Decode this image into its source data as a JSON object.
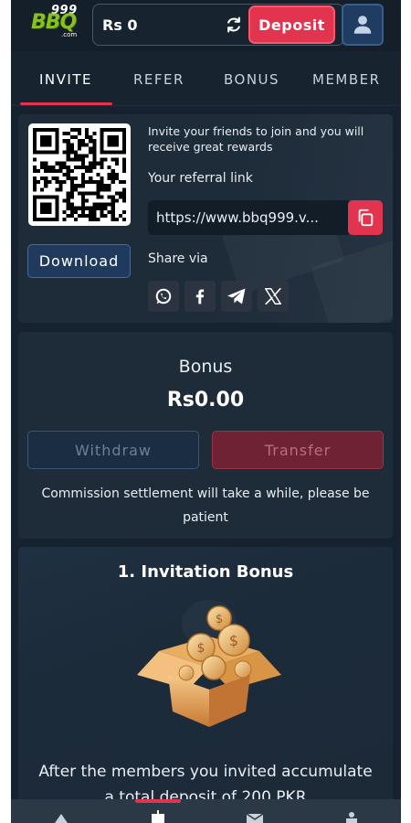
{
  "header": {
    "logo_number": "999",
    "logo_brand": "BBQ",
    "logo_domain": ".com",
    "balance": "Rs 0",
    "deposit_label": "Deposit"
  },
  "tabs": [
    {
      "label": "INVITE",
      "active": true
    },
    {
      "label": "REFER",
      "active": false
    },
    {
      "label": "BONUS",
      "active": false
    },
    {
      "label": "MEMBER",
      "active": false
    }
  ],
  "invite": {
    "description": "Invite your friends to join and you will receive great rewards",
    "referral_label": "Your referral link",
    "referral_link": "https://www.bbq999.v...",
    "download_label": "Download",
    "share_label": "Share via",
    "share_icons": [
      "whatsapp-icon",
      "facebook-icon",
      "telegram-icon",
      "x-icon"
    ]
  },
  "bonus": {
    "title": "Bonus",
    "amount": "Rs0.00",
    "withdraw_label": "Withdraw",
    "transfer_label": "Transfer",
    "note": "Commission settlement will take a while, please be patient"
  },
  "invitation_bonus": {
    "title": "1. Invitation Bonus",
    "description": "After the members you invited accumulate a total deposit of 200 PKR"
  },
  "colors": {
    "accent": "#e2344e",
    "background": "#16222f",
    "card": "#1e2c3a",
    "brand_green": "#86c11e"
  }
}
